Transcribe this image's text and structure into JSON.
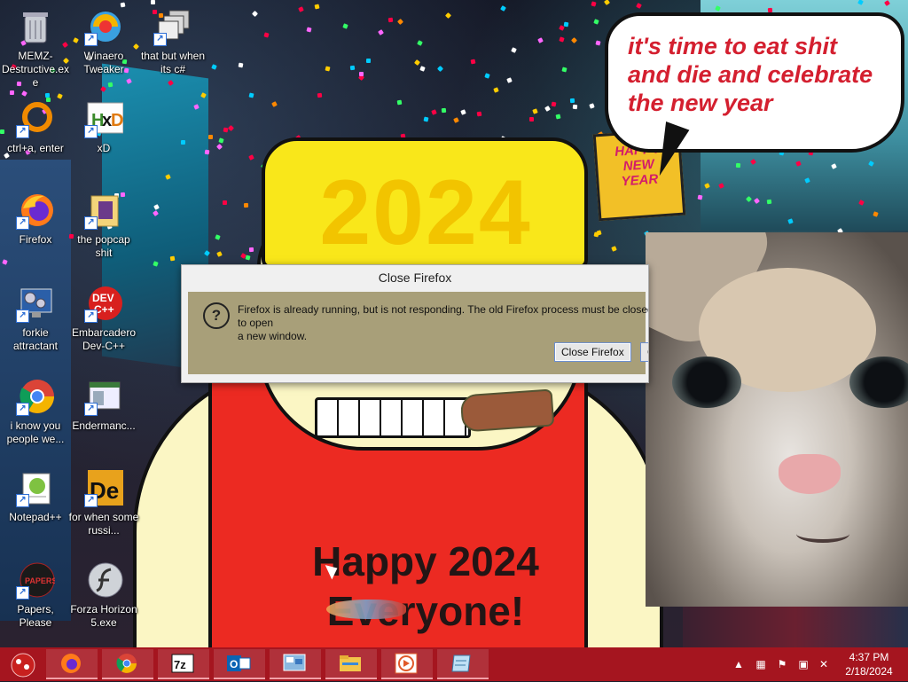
{
  "desktop": {
    "icons": [
      {
        "label": "MEMZ-Destructive.exe",
        "icon": "recycle-bin-icon"
      },
      {
        "label": "Winaero Tweaker",
        "icon": "winaero-icon"
      },
      {
        "label": "that but when its c#",
        "icon": "windows-stack-icon"
      },
      {
        "label": "ctrl+a, enter",
        "icon": "orange-ring-icon"
      },
      {
        "label": "xD",
        "icon": "hxd-icon"
      },
      {
        "label": "Firefox",
        "icon": "firefox-icon"
      },
      {
        "label": "the popcap shit",
        "icon": "popcap-folder-icon"
      },
      {
        "label": "forkie attractant",
        "icon": "settings-monitor-icon"
      },
      {
        "label": "Embarcadero Dev-C++",
        "icon": "devcpp-icon"
      },
      {
        "label": "i know you people we...",
        "icon": "chrome-icon"
      },
      {
        "label": "Endermanc...",
        "icon": "window-app-icon"
      },
      {
        "label": "Notepad++",
        "icon": "notepadpp-icon"
      },
      {
        "label": "for when some russi...",
        "icon": "de-icon"
      },
      {
        "label": "Papers, Please",
        "icon": "papers-please-icon"
      },
      {
        "label": "Forza Horizon 5.exe",
        "icon": "flash-icon"
      }
    ]
  },
  "wallpaper": {
    "hat_text": "2024",
    "bubble_line1": "it's time to eat shit",
    "bubble_line2": "and die and celebrate",
    "bubble_line3": "the new year",
    "apron_line1": "Happy 2024",
    "apron_line2": "Everyone!",
    "sign_text1": "HAPPY",
    "sign_text2": "NEW",
    "sign_text3": "YEAR"
  },
  "dialog": {
    "title": "Close Firefox",
    "message": "Firefox is already running, but is not responding. The old Firefox process must be closed to open\na new window.",
    "primary_button": "Close Firefox",
    "secondary_button": "Cancel"
  },
  "taskbar": {
    "apps": [
      "firefox-icon",
      "chrome-icon",
      "7zip-icon",
      "outlook-icon",
      "control-panel-icon",
      "file-explorer-icon",
      "media-player-icon",
      "notepad-icon"
    ],
    "tray_icons": [
      "chevron-up-icon",
      "network-icon",
      "flag-icon",
      "display-icon",
      "volume-muted-icon"
    ],
    "time": "4:37 PM",
    "date": "2/18/2024"
  },
  "colors": {
    "taskbar": "#a5151f",
    "dialog_body": "#a89f79",
    "bubble_text": "#d41f2f",
    "apron": "#ec2a22",
    "hat": "#f9e71a"
  }
}
